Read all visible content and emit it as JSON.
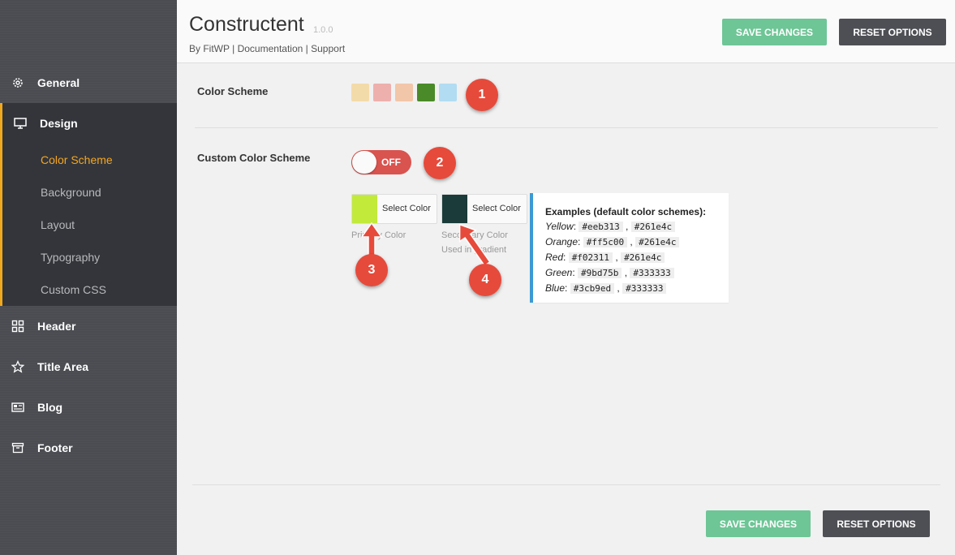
{
  "app": {
    "title": "Constructent",
    "version": "1.0.0",
    "links": [
      "By FitWP",
      "Documentation",
      "Support"
    ],
    "separator": "|"
  },
  "buttons": {
    "save": "SAVE CHANGES",
    "reset": "RESET OPTIONS"
  },
  "sidebar": {
    "items": [
      {
        "label": "General",
        "icon": "gear-icon"
      },
      {
        "label": "Design",
        "icon": "monitor-icon"
      },
      {
        "label": "Header",
        "icon": "grid-icon"
      },
      {
        "label": "Title Area",
        "icon": "star-icon"
      },
      {
        "label": "Blog",
        "icon": "newspaper-icon"
      },
      {
        "label": "Footer",
        "icon": "archive-icon"
      }
    ],
    "design_sub": [
      "Color Scheme",
      "Background",
      "Layout",
      "Typography",
      "Custom CSS"
    ],
    "active_sub": "Color Scheme"
  },
  "color_scheme": {
    "label": "Color Scheme",
    "swatches": [
      "#f3dba9",
      "#eeb0ad",
      "#f2c6a8",
      "#4a8a28",
      "#b1dcf2"
    ]
  },
  "custom_scheme": {
    "label": "Custom Color Scheme",
    "toggle_text": "OFF",
    "primary": {
      "color": "#c2ea3a",
      "button": "Select Color",
      "helper": "Primary Color"
    },
    "secondary": {
      "color": "#1a3b3a",
      "button": "Select Color",
      "helper1": "Secondary Color",
      "helper2": "Used in gradient"
    }
  },
  "examples": {
    "title": "Examples (default color schemes):",
    "rows": [
      {
        "name": "Yellow",
        "c1": "#eeb313",
        "c2": "#261e4c"
      },
      {
        "name": "Orange",
        "c1": "#ff5c00",
        "c2": "#261e4c"
      },
      {
        "name": "Red",
        "c1": "#f02311",
        "c2": "#261e4c"
      },
      {
        "name": "Green",
        "c1": "#9bd75b",
        "c2": "#333333"
      },
      {
        "name": "Blue",
        "c1": "#3cb9ed",
        "c2": "#333333"
      }
    ]
  },
  "annotations": [
    "1",
    "2",
    "3",
    "4"
  ],
  "colors": {
    "accent": "#f5a623",
    "save": "#6ec596",
    "reset": "#4e4f55",
    "badge": "#e64a3b",
    "toggle_off": "#d9534f"
  }
}
